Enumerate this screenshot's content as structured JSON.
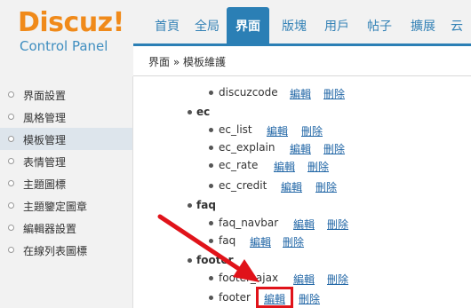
{
  "logo": {
    "brand": "Discuz!",
    "sub": "Control Panel"
  },
  "nav": {
    "tabs": [
      {
        "label": "首頁",
        "active": false
      },
      {
        "label": "全局",
        "active": false
      },
      {
        "label": "界面",
        "active": true
      },
      {
        "label": "版塊",
        "active": false
      },
      {
        "label": "用戶",
        "active": false
      },
      {
        "label": "帖子",
        "active": false
      },
      {
        "label": "擴展",
        "active": false
      },
      {
        "label": "云",
        "active": false
      }
    ]
  },
  "breadcrumb": "界面 » 模板維護",
  "sidebar": {
    "items": [
      {
        "label": "界面設置",
        "active": false
      },
      {
        "label": "風格管理",
        "active": false
      },
      {
        "label": "模板管理",
        "active": true
      },
      {
        "label": "表情管理",
        "active": false
      },
      {
        "label": "主題圖標",
        "active": false
      },
      {
        "label": "主題鑒定圖章",
        "active": false
      },
      {
        "label": "編輯器設置",
        "active": false
      },
      {
        "label": "在線列表圖標",
        "active": false
      }
    ]
  },
  "list": {
    "edit_label": "編輯",
    "delete_label": "刪除",
    "rows": [
      {
        "kind": "item",
        "name": "discuzcode"
      },
      {
        "kind": "group",
        "name": "ec"
      },
      {
        "kind": "item",
        "name": "ec_list"
      },
      {
        "kind": "item",
        "name": "ec_explain"
      },
      {
        "kind": "item",
        "name": "ec_rate"
      },
      {
        "kind": "item",
        "name": "ec_credit"
      },
      {
        "kind": "group",
        "name": "faq"
      },
      {
        "kind": "item",
        "name": "faq_navbar"
      },
      {
        "kind": "item",
        "name": "faq"
      },
      {
        "kind": "group",
        "name": "footer"
      },
      {
        "kind": "item",
        "name": "footer_ajax"
      },
      {
        "kind": "item",
        "name": "footer",
        "highlighted": true
      }
    ]
  },
  "colors": {
    "accent": "#2b7fb5",
    "brand": "#f08a1a",
    "annotation": "#e0131a",
    "link": "#2166a6"
  }
}
